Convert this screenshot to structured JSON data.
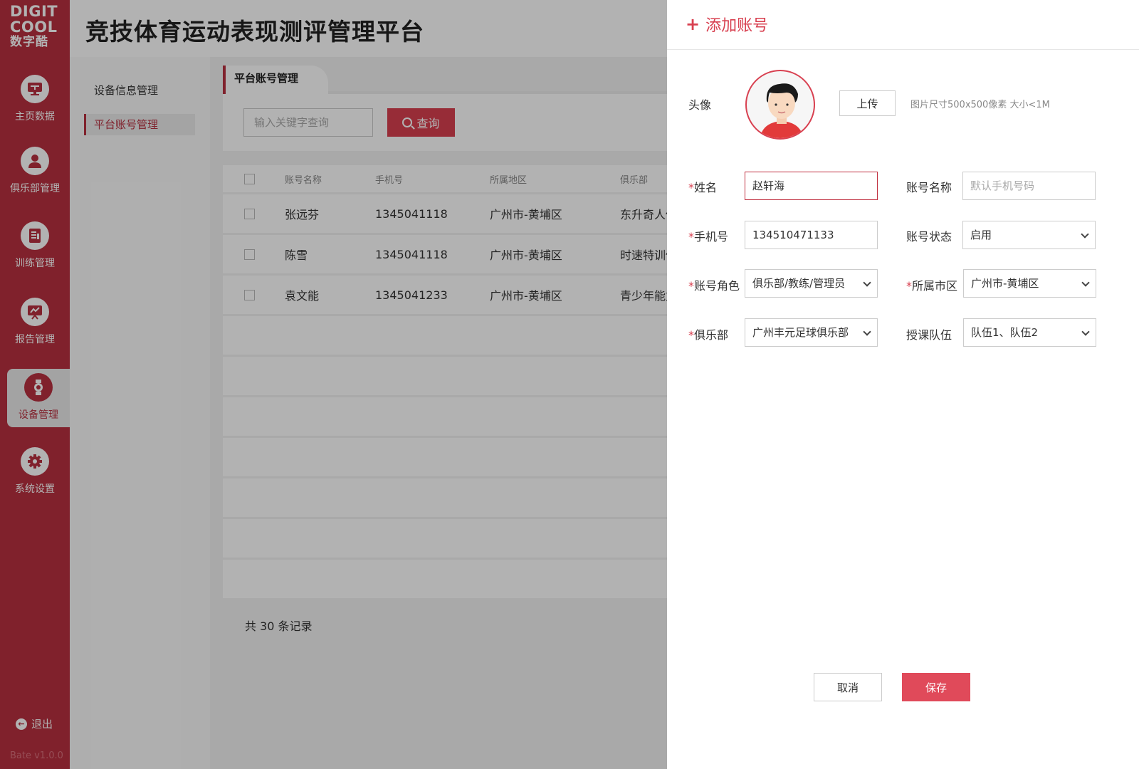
{
  "logo": {
    "line1": "DIGIT",
    "line2": "COOL",
    "line3": "数字酷"
  },
  "sidebar": {
    "items": [
      {
        "label": "主页数据",
        "icon": "monitor-icon"
      },
      {
        "label": "俱乐部管理",
        "icon": "user-icon"
      },
      {
        "label": "训练管理",
        "icon": "document-icon"
      },
      {
        "label": "报告管理",
        "icon": "report-icon"
      },
      {
        "label": "设备管理",
        "icon": "watch-icon"
      },
      {
        "label": "系统设置",
        "icon": "gear-icon"
      }
    ],
    "active_index": 4,
    "logout_label": "退出",
    "version": "Bate v1.0.0"
  },
  "header": {
    "title": "竞技体育运动表现测评管理平台"
  },
  "subnav": {
    "items": [
      {
        "label": "设备信息管理"
      },
      {
        "label": "平台账号管理"
      }
    ]
  },
  "main": {
    "tab_label": "平台账号管理",
    "search_placeholder": "输入关键字查询",
    "search_button": "查询",
    "columns": [
      "账号名称",
      "手机号",
      "所属地区",
      "俱乐部"
    ],
    "rows": [
      [
        "张远芬",
        "1345041118",
        "广州市-黄埔区",
        "东升奇人俱"
      ],
      [
        "陈雪",
        "1345041118",
        "广州市-黄埔区",
        "时速特训俱"
      ],
      [
        "袁文能",
        "1345041233",
        "广州市-黄埔区",
        "青少年能力"
      ]
    ],
    "total_text": "共 30 条记录"
  },
  "drawer": {
    "title": "添加账号",
    "avatar_label": "头像",
    "upload_button": "上传",
    "upload_hint": "图片尺寸500x500像素  大小<1M",
    "required_mark": "*",
    "name_label": "姓名",
    "name_value": "赵轩海",
    "account_name_label": "账号名称",
    "account_name_placeholder": "默认手机号码",
    "phone_label": "手机号",
    "phone_value": "134510471133",
    "status_label": "账号状态",
    "status_value": "启用",
    "role_label": "账号角色",
    "role_value": "俱乐部/教练/管理员",
    "city_label": "所属市区",
    "city_value": "广州市-黄埔区",
    "club_label": "俱乐部",
    "club_value": "广州丰元足球俱乐部",
    "team_label": "授课队伍",
    "team_value": "队伍1、队伍2",
    "cancel_button": "取消",
    "save_button": "保存"
  },
  "colors": {
    "brand": "#b8303f",
    "accent": "#e04a5a"
  }
}
